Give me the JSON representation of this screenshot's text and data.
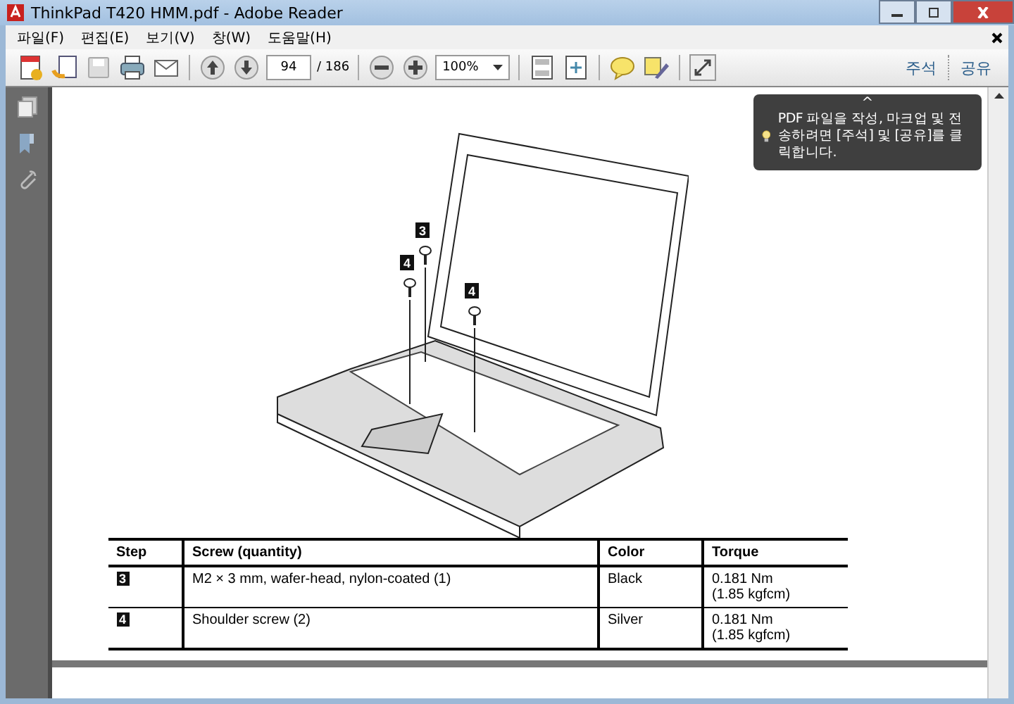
{
  "window": {
    "title": "ThinkPad T420 HMM.pdf - Adobe Reader"
  },
  "menu": [
    "파일(F)",
    "편집(E)",
    "보기(V)",
    "창(W)",
    "도움말(H)"
  ],
  "toolbar": {
    "page": "94",
    "page_count": "/ 186",
    "zoom": "100%",
    "right_buttons": [
      "주석",
      "공유"
    ]
  },
  "tooltip": {
    "arrow": "^",
    "text": "PDF 파일을 작성, 마크업 및 전송하려면 [주석] 및 [공유]를 클릭합니다."
  },
  "figure": {
    "callouts": [
      {
        "label": "3"
      },
      {
        "label": "4"
      },
      {
        "label": "4"
      }
    ]
  },
  "table": {
    "columns": [
      "Step",
      "Screw (quantity)",
      "Color",
      "Torque"
    ],
    "rows": [
      {
        "step": "3",
        "screw": "M2 × 3 mm, wafer-head, nylon-coated (1)",
        "screw_color": "Black",
        "torque": [
          "0.181 Nm",
          "(1.85 kgfcm)"
        ]
      },
      {
        "step": "4",
        "screw": "Shoulder screw (2)",
        "screw_color": "Silver",
        "torque": [
          "0.181 Nm",
          "(1.85 kgfcm)"
        ]
      }
    ]
  }
}
